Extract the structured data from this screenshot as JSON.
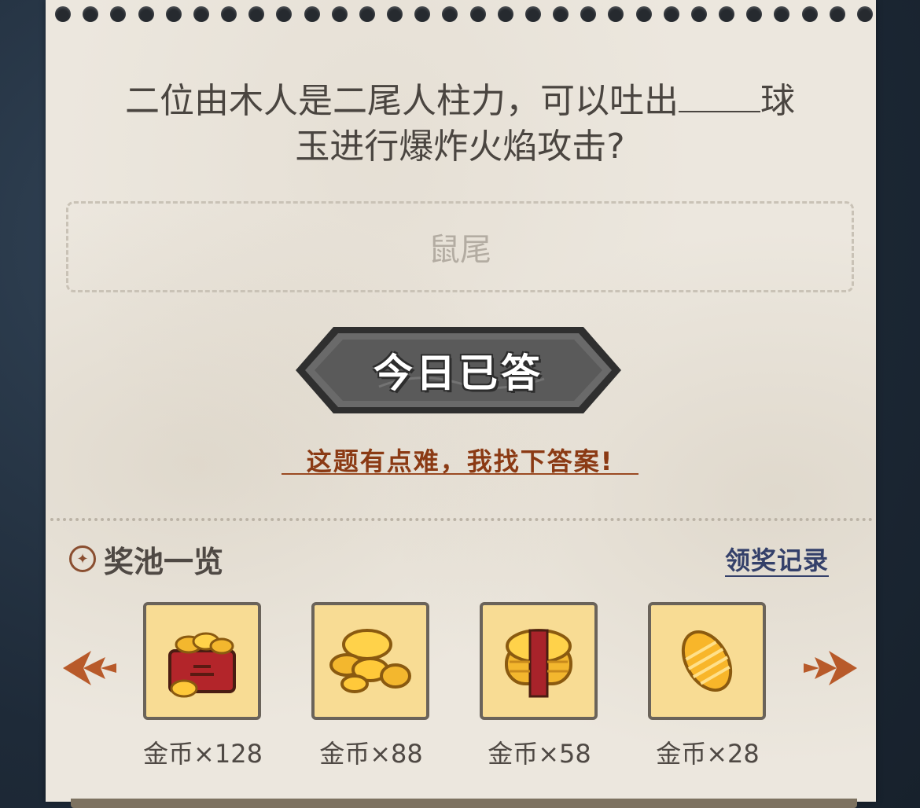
{
  "question": {
    "line1_before_blank": "二位由木人是二尾人柱力，可以吐出",
    "line1_after_blank": "球",
    "line2": "玉进行爆炸火焰攻击?"
  },
  "answer": {
    "value": "鼠尾"
  },
  "answer_button": {
    "label": "今日已答"
  },
  "hint_link": {
    "label": "这题有点难，我找下答案!"
  },
  "reward_pool": {
    "title": "奖池一览",
    "records_label": "领奖记录",
    "items": [
      {
        "label": "金币×128",
        "icon": "coin-box-icon"
      },
      {
        "label": "金币×88",
        "icon": "coin-pile-icon"
      },
      {
        "label": "金币×58",
        "icon": "coin-stack-icon"
      },
      {
        "label": "金币×28",
        "icon": "coin-icon"
      }
    ]
  },
  "colors": {
    "paper": "#ece7de",
    "button": "#5c5c5c",
    "hint": "#8b3a14",
    "link": "#34406a",
    "tile": "#f8dc94",
    "arrow": "#b85a2a"
  }
}
